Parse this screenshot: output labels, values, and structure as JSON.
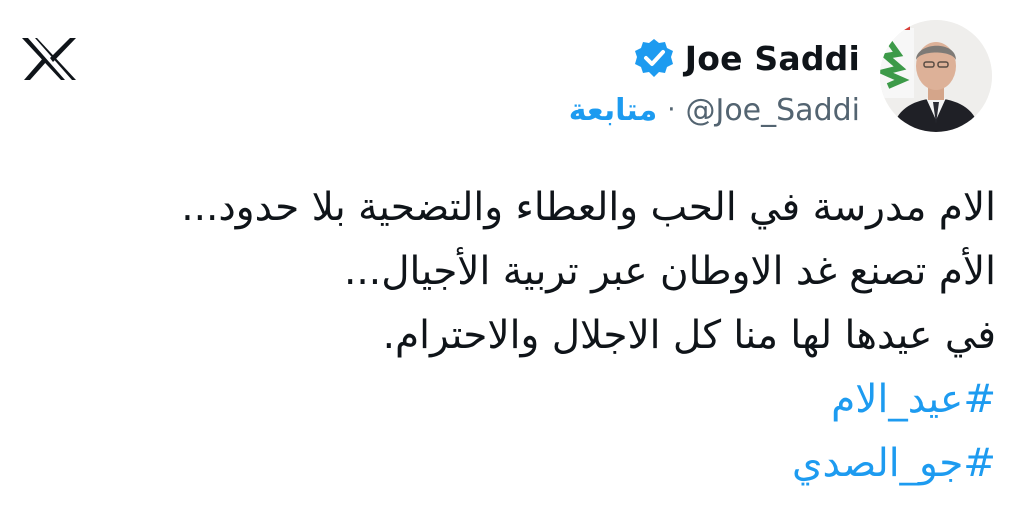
{
  "app": {
    "logo_icon": "x-logo-icon"
  },
  "author": {
    "display_name": "Joe Saddi",
    "handle": "@Joe_Saddi",
    "separator": "·",
    "follow_label": "متابعة",
    "verified_icon": "verified-badge-icon",
    "verified_color": "#1d9bf0"
  },
  "tweet": {
    "lines": [
      "الام مدرسة في الحب والعطاء والتضحية بلا حدود...",
      "الأم تصنع غد الاوطان عبر تربية الأجيال...",
      "في عيدها لها منا كل الاجلال والاحترام."
    ],
    "hashtags": [
      "#عيد_الام",
      "#جو_الصدي"
    ]
  },
  "colors": {
    "text": "#0f1419",
    "secondary": "#536471",
    "accent": "#1d9bf0"
  }
}
